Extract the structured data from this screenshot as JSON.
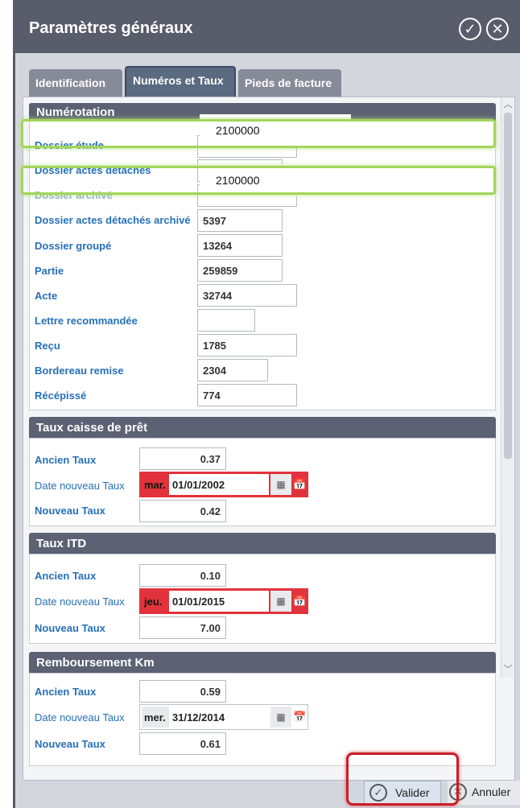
{
  "window": {
    "title": "Paramètres généraux"
  },
  "tabs": [
    {
      "label": "Identification"
    },
    {
      "label": "Numéros et Taux"
    },
    {
      "label": "Pieds de facture"
    }
  ],
  "numerotation": {
    "header": "Numérotation",
    "fields": [
      {
        "label": "Dossier étude",
        "value": ""
      },
      {
        "label": "Dossier actes détachés",
        "value": ""
      },
      {
        "label": "Dossier archivé",
        "value": ""
      },
      {
        "label": "Dossier actes détachés archivé",
        "value": "5397"
      },
      {
        "label": "Dossier groupé",
        "value": "13264"
      },
      {
        "label": "Partie",
        "value": "259859"
      },
      {
        "label": "Acte",
        "value": "32744"
      },
      {
        "label": "Lettre recommandée",
        "value": ""
      },
      {
        "label": "Reçu",
        "value": "1785"
      },
      {
        "label": "Bordereau remise",
        "value": "2304"
      },
      {
        "label": "Récépissé",
        "value": "774"
      }
    ],
    "overlay_1": "2100000",
    "overlay_2": "2100000"
  },
  "rate_sections": [
    {
      "header": "Taux caisse de prêt",
      "ancien_label": "Ancien Taux",
      "ancien": "0.37",
      "date_label": "Date nouveau Taux",
      "day": "mar.",
      "date": "01/01/2002",
      "nouveau_label": "Nouveau Taux",
      "nouveau": "0.42"
    },
    {
      "header": "Taux ITD",
      "ancien_label": "Ancien Taux",
      "ancien": "0.10",
      "date_label": "Date nouveau Taux",
      "day": "jeu.",
      "date": "01/01/2015",
      "nouveau_label": "Nouveau Taux",
      "nouveau": "7.00"
    },
    {
      "header": "Remboursement Km",
      "ancien_label": "Ancien Taux",
      "ancien": "0.59",
      "date_label": "Date nouveau Taux",
      "day": "mer.",
      "date": "31/12/2014",
      "nouveau_label": "Nouveau Taux",
      "nouveau": "0.61"
    }
  ],
  "buttons": {
    "valider": "Valider",
    "annuler": "Annuler"
  },
  "colors": {
    "titlebar": "#595c6a",
    "section_header": "#5c6273",
    "label_blue": "#2670b8",
    "date_error": "#e2333c",
    "highlight_green": "#a3d55a",
    "highlight_red": "#c81e2b"
  },
  "icons": {
    "validate": "check-circle-icon",
    "close": "x-circle-icon",
    "calendar": "calendar-grid-icon",
    "today": "calendar-today-icon"
  }
}
